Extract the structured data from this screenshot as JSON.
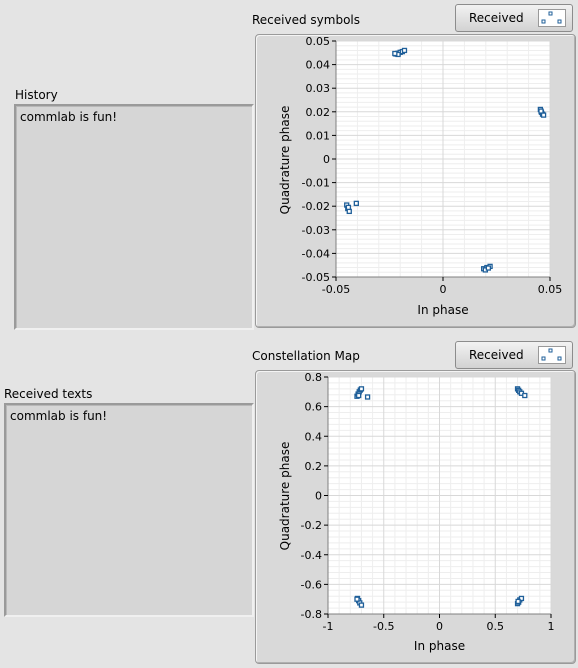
{
  "history": {
    "label": "History",
    "text": "commlab is fun!"
  },
  "received_texts": {
    "label": "Received texts",
    "text": "commlab is fun!"
  },
  "received_symbols": {
    "label": "Received symbols",
    "legend_label": "Received",
    "xlabel": "In phase",
    "ylabel": "Quadrature phase"
  },
  "constellation_map": {
    "label": "Constellation Map",
    "legend_label": "Received",
    "xlabel": "In phase",
    "ylabel": "Quadrature phase"
  },
  "colors": {
    "marker": "#1f5f99",
    "grid_major": "#d8d8d8",
    "grid_minor": "#eeeeee"
  },
  "chart_data": [
    {
      "type": "scatter",
      "name_ref": "received_symbols",
      "xlabel": "In phase",
      "ylabel": "Quadrature phase",
      "xlim": [
        -0.05,
        0.05
      ],
      "ylim": [
        -0.05,
        0.05
      ],
      "x_ticks": [
        -0.05,
        0,
        0.05
      ],
      "x_tick_labels": [
        "-0.05",
        "0",
        "0.05"
      ],
      "y_ticks": [
        0.05,
        0.04,
        0.03,
        0.02,
        0.01,
        0,
        -0.01,
        -0.02,
        -0.03,
        -0.04,
        -0.05
      ],
      "y_tick_labels": [
        "0.05",
        "0.04",
        "0.03",
        "0.02",
        "0.01",
        "0",
        "-0.01",
        "-0.02",
        "-0.03",
        "-0.04",
        "-0.05"
      ],
      "grid": true,
      "series": [
        {
          "name": "Received",
          "points": [
            [
              -0.022,
              0.0445
            ],
            [
              -0.021,
              0.0448
            ],
            [
              -0.02,
              0.0452
            ],
            [
              -0.019,
              0.0455
            ],
            [
              -0.021,
              0.0443
            ],
            [
              -0.018,
              0.046
            ],
            [
              -0.0225,
              0.0447
            ],
            [
              0.0455,
              0.021
            ],
            [
              0.046,
              0.0198
            ],
            [
              0.0465,
              0.019
            ],
            [
              0.0458,
              0.0203
            ],
            [
              0.047,
              0.0186
            ],
            [
              -0.045,
              -0.0195
            ],
            [
              -0.0445,
              -0.021
            ],
            [
              -0.0438,
              -0.0222
            ],
            [
              -0.0442,
              -0.0205
            ],
            [
              -0.0405,
              -0.0188
            ],
            [
              0.019,
              -0.0465
            ],
            [
              0.0205,
              -0.046
            ],
            [
              0.022,
              -0.0455
            ],
            [
              0.0198,
              -0.047
            ],
            [
              0.0212,
              -0.0462
            ]
          ]
        }
      ]
    },
    {
      "type": "scatter",
      "name_ref": "constellation_map",
      "xlabel": "In phase",
      "ylabel": "Quadrature phase",
      "xlim": [
        -1,
        1
      ],
      "ylim": [
        -0.8,
        0.8
      ],
      "x_ticks": [
        -1,
        -0.5,
        0,
        0.5,
        1
      ],
      "x_tick_labels": [
        "-1",
        "-0.5",
        "0",
        "0.5",
        "1"
      ],
      "y_ticks": [
        0.8,
        0.6,
        0.4,
        0.2,
        0,
        -0.2,
        -0.4,
        -0.6,
        -0.8
      ],
      "y_tick_labels": [
        "0.8",
        "0.6",
        "0.4",
        "0.2",
        "0",
        "-0.2",
        "-0.4",
        "-0.6",
        "-0.8"
      ],
      "grid": true,
      "series": [
        {
          "name": "Received",
          "points": [
            [
              -0.74,
              0.67
            ],
            [
              -0.73,
              0.685
            ],
            [
              -0.72,
              0.7
            ],
            [
              -0.71,
              0.712
            ],
            [
              -0.725,
              0.675
            ],
            [
              -0.7,
              0.72
            ],
            [
              -0.645,
              0.665
            ],
            [
              0.7,
              0.72
            ],
            [
              0.71,
              0.71
            ],
            [
              0.72,
              0.7
            ],
            [
              0.735,
              0.69
            ],
            [
              0.765,
              0.675
            ],
            [
              -0.735,
              -0.695
            ],
            [
              -0.725,
              -0.71
            ],
            [
              -0.715,
              -0.725
            ],
            [
              -0.7,
              -0.74
            ],
            [
              -0.74,
              -0.7
            ],
            [
              0.7,
              -0.73
            ],
            [
              0.71,
              -0.72
            ],
            [
              0.72,
              -0.705
            ],
            [
              0.735,
              -0.695
            ],
            [
              0.705,
              -0.715
            ]
          ]
        }
      ]
    }
  ]
}
